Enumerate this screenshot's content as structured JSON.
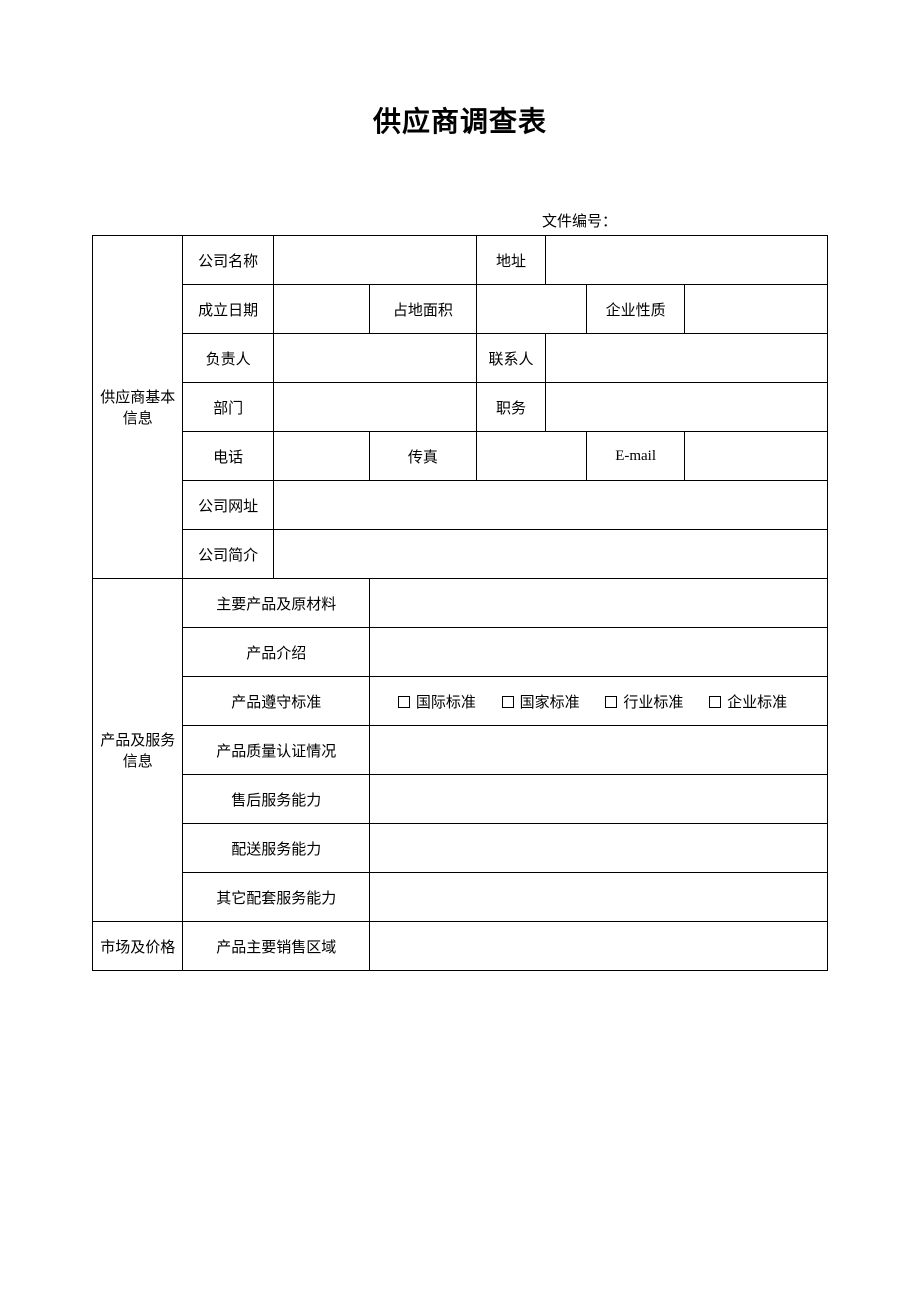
{
  "title": "供应商调查表",
  "doc_number_label": "文件编号：",
  "section1": {
    "header": "供应商基本信息",
    "company_name": "公司名称",
    "address": "地址",
    "establish_date": "成立日期",
    "land_area": "占地面积",
    "entity_nature": "企业性质",
    "principal": "负责人",
    "contact": "联系人",
    "department": "部门",
    "position": "职务",
    "phone": "电话",
    "fax": "传真",
    "email": "E-mail",
    "website": "公司网址",
    "profile": "公司简介"
  },
  "section2": {
    "header": "产品及服务信息",
    "main_products_materials": "主要产品及原材料",
    "product_intro": "产品介绍",
    "product_standard": "产品遵守标准",
    "standard_options": [
      "国际标准",
      "国家标准",
      "行业标准",
      "企业标准"
    ],
    "quality_cert": "产品质量认证情况",
    "after_sales": "售后服务能力",
    "delivery": "配送服务能力",
    "other_services": "其它配套服务能力"
  },
  "section3": {
    "header": "市场及价格",
    "main_sales_region": "产品主要销售区域"
  }
}
